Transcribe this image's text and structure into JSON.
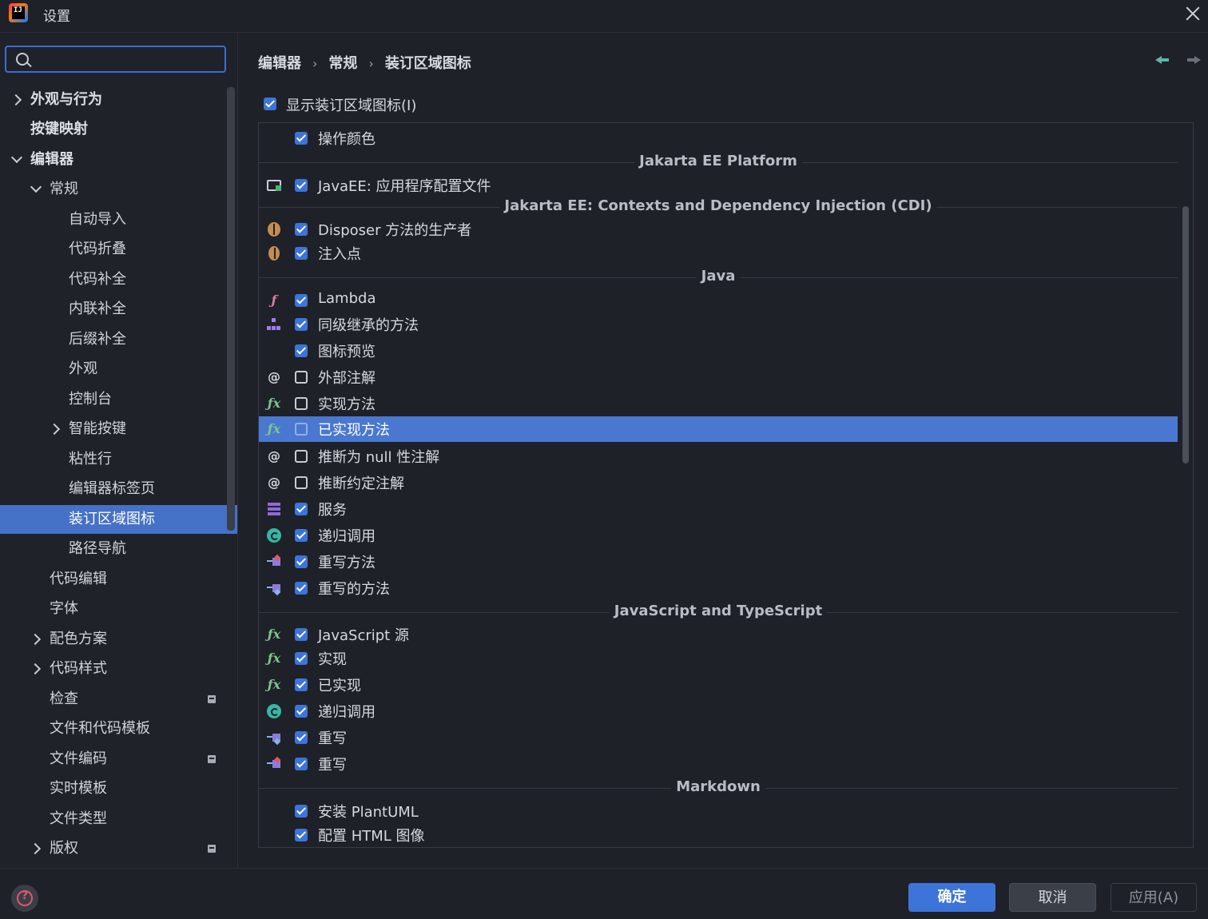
{
  "window": {
    "title": "设置"
  },
  "search": {
    "placeholder": "",
    "value": ""
  },
  "sidebar": {
    "items": [
      {
        "label": "外观与行为"
      },
      {
        "label": "按键映射"
      },
      {
        "label": "编辑器"
      },
      {
        "label": "常规"
      },
      {
        "label": "自动导入"
      },
      {
        "label": "代码折叠"
      },
      {
        "label": "代码补全"
      },
      {
        "label": "内联补全"
      },
      {
        "label": "后缀补全"
      },
      {
        "label": "外观"
      },
      {
        "label": "控制台"
      },
      {
        "label": "智能按键"
      },
      {
        "label": "粘性行"
      },
      {
        "label": "编辑器标签页"
      },
      {
        "label": "装订区域图标"
      },
      {
        "label": "路径导航"
      },
      {
        "label": "代码编辑"
      },
      {
        "label": "字体"
      },
      {
        "label": "配色方案"
      },
      {
        "label": "代码样式"
      },
      {
        "label": "检查"
      },
      {
        "label": "文件和代码模板"
      },
      {
        "label": "文件编码"
      },
      {
        "label": "实时模板"
      },
      {
        "label": "文件类型"
      },
      {
        "label": "版权"
      }
    ]
  },
  "breadcrumb": {
    "c1": "编辑器",
    "c2": "常规",
    "c3": "装订区域图标",
    "sep": "›"
  },
  "main": {
    "show_gutter_label": "显示装订区域图标(I)",
    "show_gutter_checked": true
  },
  "panel": {
    "groups": {
      "jakarta": "Jakarta EE Platform",
      "cdi": "Jakarta EE: Contexts and Dependency Injection (CDI)",
      "java": "Java",
      "js": "JavaScript and TypeScript",
      "markdown": "Markdown"
    },
    "rows": [
      {
        "label": "操作颜色",
        "checked": true,
        "icon": "none"
      },
      {
        "label": "JavaEE: 应用程序配置文件",
        "checked": true,
        "icon": "config-folder-icon"
      },
      {
        "label": "Disposer 方法的生产者",
        "checked": true,
        "icon": "bean-icon"
      },
      {
        "label": "注入点",
        "checked": true,
        "icon": "bean-icon"
      },
      {
        "label": "Lambda",
        "checked": true,
        "icon": "lambda-icon"
      },
      {
        "label": "同级继承的方法",
        "checked": true,
        "icon": "hierarchy-icon"
      },
      {
        "label": "图标预览",
        "checked": true,
        "icon": "none"
      },
      {
        "label": "外部注解",
        "checked": false,
        "icon": "at-icon"
      },
      {
        "label": "实现方法",
        "checked": false,
        "icon": "implementing-icon"
      },
      {
        "label": "已实现方法",
        "checked": false,
        "icon": "implemented-icon"
      },
      {
        "label": "推断为 null 性注解",
        "checked": false,
        "icon": "at-icon"
      },
      {
        "label": "推断约定注解",
        "checked": false,
        "icon": "at-icon"
      },
      {
        "label": "服务",
        "checked": true,
        "icon": "services-icon"
      },
      {
        "label": "递归调用",
        "checked": true,
        "icon": "recursion-icon"
      },
      {
        "label": "重写方法",
        "checked": true,
        "icon": "overriding-icon"
      },
      {
        "label": "重写的方法",
        "checked": true,
        "icon": "overridden-icon"
      },
      {
        "label": "JavaScript 源",
        "checked": true,
        "icon": "fx-icon"
      },
      {
        "label": "实现",
        "checked": true,
        "icon": "implementing-icon"
      },
      {
        "label": "已实现",
        "checked": true,
        "icon": "implemented-icon"
      },
      {
        "label": "递归调用",
        "checked": true,
        "icon": "recursion-icon"
      },
      {
        "label": "重写",
        "checked": true,
        "icon": "overridden-icon"
      },
      {
        "label": "重写",
        "checked": true,
        "icon": "overriding-icon"
      },
      {
        "label": "安装 PlantUML",
        "checked": true,
        "icon": "none"
      },
      {
        "label": "配置 HTML 图像",
        "checked": true,
        "icon": "none"
      }
    ]
  },
  "buttons": {
    "ok": "确定",
    "cancel": "取消",
    "apply": "应用(A)",
    "help": "?"
  },
  "colors": {
    "accent": "#3d74d9",
    "selection": "#4a78d0",
    "background": "#1e2128"
  }
}
